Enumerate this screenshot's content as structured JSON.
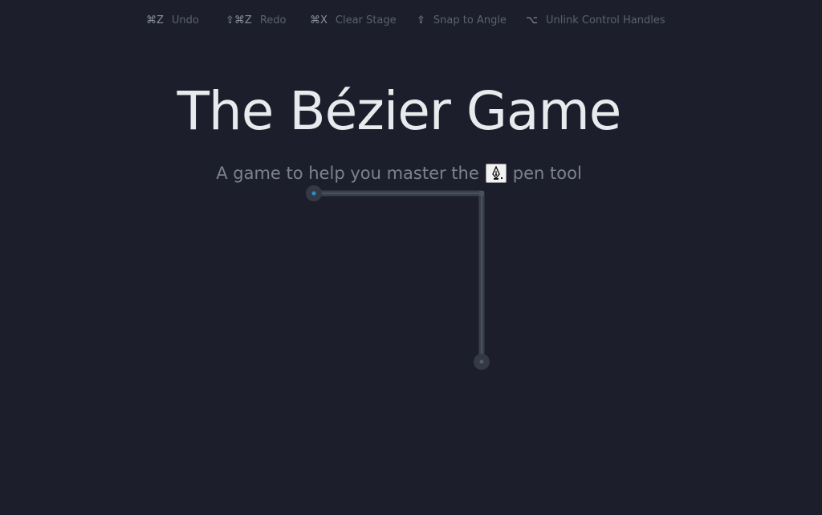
{
  "shortcuts": [
    {
      "key": "⌘Z",
      "label": "Undo",
      "icon": "command-z"
    },
    {
      "key": "⇧⌘Z",
      "label": "Redo",
      "icon": "shift-command-z"
    },
    {
      "key": "⌘X",
      "label": "Clear Stage",
      "icon": "command-x"
    },
    {
      "key": "⇧",
      "label": "Snap to Angle",
      "icon": "shift-arrow"
    },
    {
      "key": "⌥",
      "label": "Unlink Control Handles",
      "icon": "option-key"
    }
  ],
  "header": {
    "title": "The Bézier Game",
    "subtitle_before": "A game to help you master the",
    "subtitle_after": "pen tool",
    "pen_icon": "pen-tool-icon"
  },
  "colors": {
    "background": "#1c1f2b",
    "title": "#e8eaee",
    "subtitle": "#7c8190",
    "path": "#3a3f4c",
    "anchor_active": "#2f8fc4"
  }
}
